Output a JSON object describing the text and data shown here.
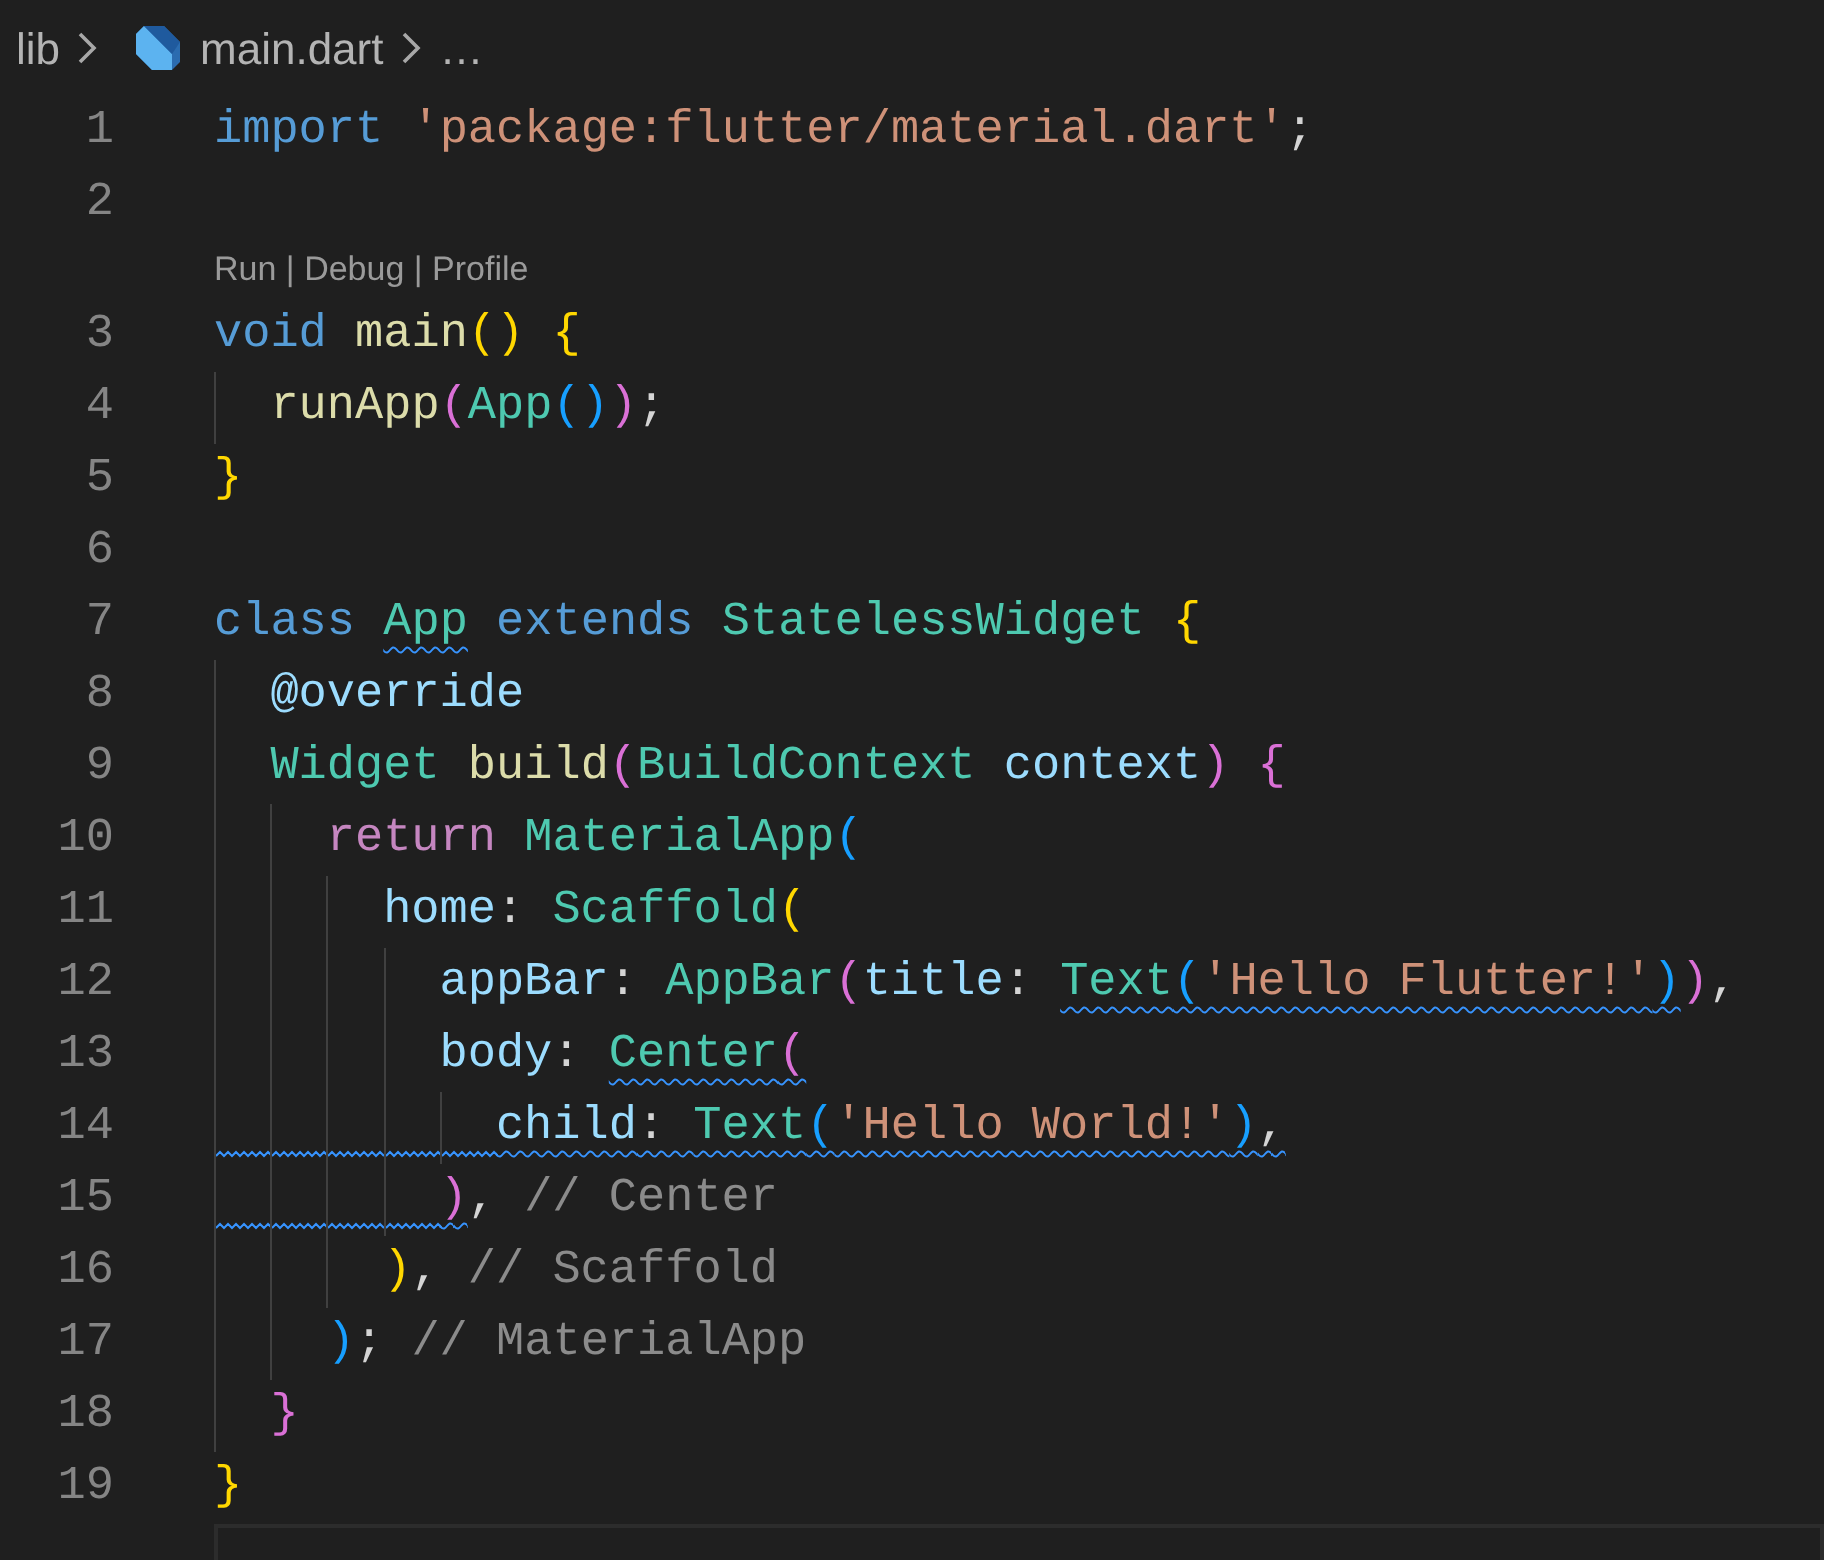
{
  "breadcrumb": {
    "folder": "lib",
    "file": "main.dart",
    "more": "…"
  },
  "lines": [
    {
      "number": "1",
      "tokens": [
        {
          "text": "import ",
          "kind": "keyword"
        },
        {
          "text": "'package:flutter/material.dart'",
          "kind": "string"
        },
        {
          "text": ";",
          "kind": "punct"
        }
      ]
    },
    {
      "number": "2"
    },
    {
      "kind": "codelens",
      "parts": [
        {
          "text": "Run",
          "kind": "link"
        },
        {
          "text": " | ",
          "kind": "separator"
        },
        {
          "text": "Debug",
          "kind": "link"
        },
        {
          "text": " | ",
          "kind": "separator"
        },
        {
          "text": "Profile",
          "kind": "link"
        }
      ]
    },
    {
      "number": "3",
      "tokens": [
        {
          "text": "void ",
          "kind": "keyword"
        },
        {
          "text": "main",
          "kind": "function"
        },
        {
          "text": "() {",
          "kind": "bracket1"
        }
      ]
    },
    {
      "number": "4",
      "guides": [
        {
          "warning": false
        }
      ],
      "tokens": [
        {
          "text": "runApp",
          "kind": "function"
        },
        {
          "text": "(",
          "kind": "bracket2"
        },
        {
          "text": "App",
          "kind": "class"
        },
        {
          "text": "()",
          "kind": "bracket3"
        },
        {
          "text": ")",
          "kind": "bracket2"
        },
        {
          "text": ";",
          "kind": "punct"
        }
      ]
    },
    {
      "number": "5",
      "tokens": [
        {
          "text": "}",
          "kind": "bracket1"
        }
      ]
    },
    {
      "number": "6"
    },
    {
      "number": "7",
      "tokens": [
        {
          "text": "class ",
          "kind": "keyword"
        },
        {
          "text": "App",
          "kind": "class",
          "warning": true
        },
        {
          "text": " extends ",
          "kind": "keyword"
        },
        {
          "text": "StatelessWidget ",
          "kind": "class"
        },
        {
          "text": "{",
          "kind": "bracket1"
        }
      ]
    },
    {
      "number": "8",
      "guides": [
        {
          "warning": false
        }
      ],
      "tokens": [
        {
          "text": "@override",
          "kind": "variable"
        }
      ]
    },
    {
      "number": "9",
      "guides": [
        {
          "warning": false
        }
      ],
      "tokens": [
        {
          "text": "Widget ",
          "kind": "class"
        },
        {
          "text": "build",
          "kind": "function"
        },
        {
          "text": "(",
          "kind": "bracket2"
        },
        {
          "text": "BuildContext ",
          "kind": "class"
        },
        {
          "text": "context",
          "kind": "variable"
        },
        {
          "text": ") {",
          "kind": "bracket2"
        }
      ]
    },
    {
      "number": "10",
      "guides": [
        {
          "warning": false
        },
        {
          "warning": false
        }
      ],
      "tokens": [
        {
          "text": "return ",
          "kind": "control"
        },
        {
          "text": "MaterialApp",
          "kind": "class"
        },
        {
          "text": "(",
          "kind": "bracket3"
        }
      ]
    },
    {
      "number": "11",
      "guides": [
        {
          "warning": false
        },
        {
          "warning": false
        },
        {
          "warning": false
        }
      ],
      "tokens": [
        {
          "text": "home",
          "kind": "variable"
        },
        {
          "text": ": ",
          "kind": "punct"
        },
        {
          "text": "Scaffold",
          "kind": "class"
        },
        {
          "text": "(",
          "kind": "bracket1"
        }
      ]
    },
    {
      "number": "12",
      "guides": [
        {
          "warning": false
        },
        {
          "warning": false
        },
        {
          "warning": false
        },
        {
          "warning": false
        }
      ],
      "tokens": [
        {
          "text": "appBar",
          "kind": "variable"
        },
        {
          "text": ": ",
          "kind": "punct"
        },
        {
          "text": "AppBar",
          "kind": "class"
        },
        {
          "text": "(",
          "kind": "bracket2"
        },
        {
          "text": "title",
          "kind": "variable"
        },
        {
          "text": ": ",
          "kind": "punct"
        },
        {
          "text": "Text",
          "kind": "class",
          "warning": true
        },
        {
          "text": "(",
          "kind": "bracket3",
          "warning": true
        },
        {
          "text": "'Hello Flutter!'",
          "kind": "string",
          "warning": true
        },
        {
          "text": ")",
          "kind": "bracket3",
          "warning": true
        },
        {
          "text": ")",
          "kind": "bracket2"
        },
        {
          "text": ",",
          "kind": "punct"
        }
      ]
    },
    {
      "number": "13",
      "guides": [
        {
          "warning": false
        },
        {
          "warning": false
        },
        {
          "warning": false
        },
        {
          "warning": false
        }
      ],
      "tokens": [
        {
          "text": "body",
          "kind": "variable"
        },
        {
          "text": ": ",
          "kind": "punct"
        },
        {
          "text": "Center",
          "kind": "class",
          "warning": true
        },
        {
          "text": "(",
          "kind": "bracket2",
          "warning": true
        }
      ]
    },
    {
      "number": "14",
      "guides": [
        {
          "warning": true
        },
        {
          "warning": true
        },
        {
          "warning": true
        },
        {
          "warning": true
        },
        {
          "warning": true
        }
      ],
      "tokens": [
        {
          "text": "child",
          "kind": "variable",
          "warning": true
        },
        {
          "text": ": ",
          "kind": "punct",
          "warning": true
        },
        {
          "text": "Text",
          "kind": "class",
          "warning": true
        },
        {
          "text": "(",
          "kind": "bracket3",
          "warning": true
        },
        {
          "text": "'Hello World!'",
          "kind": "string",
          "warning": true
        },
        {
          "text": ")",
          "kind": "bracket3",
          "warning": true
        },
        {
          "text": ",",
          "kind": "punct",
          "warning": true
        }
      ]
    },
    {
      "number": "15",
      "guides": [
        {
          "warning": true
        },
        {
          "warning": true
        },
        {
          "warning": true
        },
        {
          "warning": true
        }
      ],
      "tokens": [
        {
          "text": ")",
          "kind": "bracket2",
          "warning": true
        },
        {
          "text": ", ",
          "kind": "punct"
        },
        {
          "text": "// Center",
          "kind": "comment"
        }
      ]
    },
    {
      "number": "16",
      "guides": [
        {
          "warning": false
        },
        {
          "warning": false
        },
        {
          "warning": false
        }
      ],
      "tokens": [
        {
          "text": ")",
          "kind": "bracket1"
        },
        {
          "text": ", ",
          "kind": "punct"
        },
        {
          "text": "// Scaffold",
          "kind": "comment"
        }
      ]
    },
    {
      "number": "17",
      "guides": [
        {
          "warning": false
        },
        {
          "warning": false
        }
      ],
      "tokens": [
        {
          "text": ")",
          "kind": "bracket3"
        },
        {
          "text": "; ",
          "kind": "punct"
        },
        {
          "text": "// MaterialApp",
          "kind": "comment"
        }
      ]
    },
    {
      "number": "18",
      "guides": [
        {
          "warning": false
        }
      ],
      "tokens": [
        {
          "text": "}",
          "kind": "bracket2"
        }
      ]
    },
    {
      "number": "19",
      "tokens": [
        {
          "text": "}",
          "kind": "bracket1"
        }
      ]
    },
    {
      "current": true
    }
  ]
}
